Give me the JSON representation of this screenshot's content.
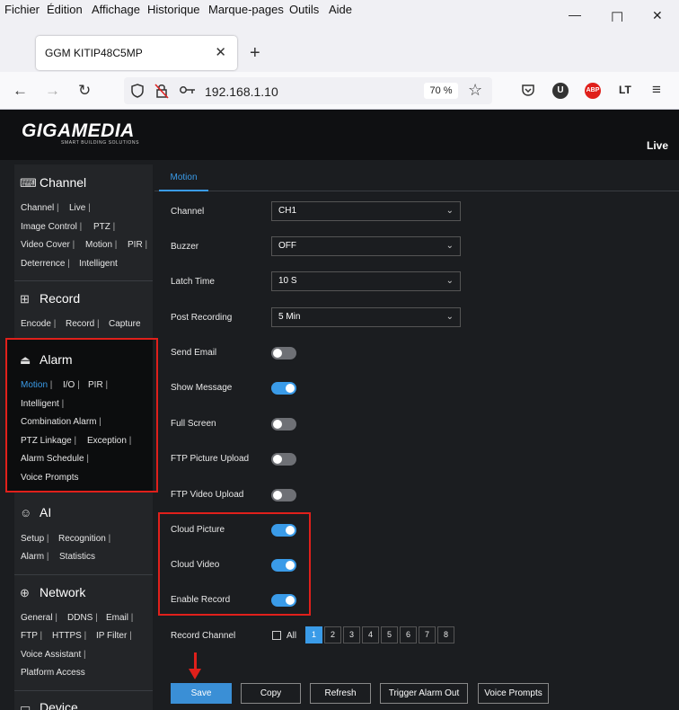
{
  "browser": {
    "menu": [
      "Fichier",
      "Édition",
      "Affichage",
      "Historique",
      "Marque-pages",
      "Outils",
      "Aide"
    ],
    "tab_title": "GGM KITIP48C5MP",
    "url": "192.168.1.10",
    "zoom": "70 %",
    "win_minimize": "—",
    "win_maximize": "☐",
    "win_close": "✕"
  },
  "app": {
    "logo": "GIGAMEDIA",
    "logo_sub": "SMART BUILDING SOLUTIONS",
    "live": "Live"
  },
  "sidebar": {
    "channel": {
      "title": "Channel",
      "links": [
        "Channel",
        "Live",
        "Image Control",
        "PTZ",
        "Video Cover",
        "Motion",
        "PIR",
        "Deterrence",
        "Intelligent"
      ]
    },
    "record": {
      "title": "Record",
      "links": [
        "Encode",
        "Record",
        "Capture"
      ]
    },
    "alarm": {
      "title": "Alarm",
      "links": [
        "Motion",
        "I/O",
        "PIR",
        "Intelligent",
        "Combination Alarm",
        "PTZ Linkage",
        "Exception",
        "Alarm Schedule",
        "Voice Prompts"
      ]
    },
    "ai": {
      "title": "AI",
      "links": [
        "Setup",
        "Recognition",
        "Alarm",
        "Statistics"
      ]
    },
    "network": {
      "title": "Network",
      "links": [
        "General",
        "DDNS",
        "Email",
        "FTP",
        "HTTPS",
        "IP Filter",
        "Voice Assistant",
        "Platform Access"
      ]
    },
    "device": {
      "title": "Device"
    }
  },
  "content": {
    "active_tab": "Motion",
    "fields": {
      "channel": {
        "label": "Channel",
        "value": "CH1"
      },
      "buzzer": {
        "label": "Buzzer",
        "value": "OFF"
      },
      "latch": {
        "label": "Latch Time",
        "value": "10 S"
      },
      "post": {
        "label": "Post Recording",
        "value": "5 Min"
      }
    },
    "toggles": [
      {
        "label": "Send Email",
        "on": false
      },
      {
        "label": "Show Message",
        "on": true
      },
      {
        "label": "Full Screen",
        "on": false
      },
      {
        "label": "FTP Picture Upload",
        "on": false
      },
      {
        "label": "FTP Video Upload",
        "on": false
      },
      {
        "label": "Cloud Picture",
        "on": true
      },
      {
        "label": "Cloud Video",
        "on": true
      },
      {
        "label": "Enable Record",
        "on": true
      }
    ],
    "record_channel": {
      "label": "Record Channel",
      "all_label": "All",
      "channels": [
        "1",
        "2",
        "3",
        "4",
        "5",
        "6",
        "7",
        "8"
      ],
      "selected": "1"
    },
    "buttons": {
      "save": "Save",
      "copy": "Copy",
      "refresh": "Refresh",
      "trigger": "Trigger Alarm Out",
      "voice": "Voice Prompts"
    }
  },
  "colors": {
    "accent": "#3a9be8",
    "annotation": "#e0201b"
  }
}
